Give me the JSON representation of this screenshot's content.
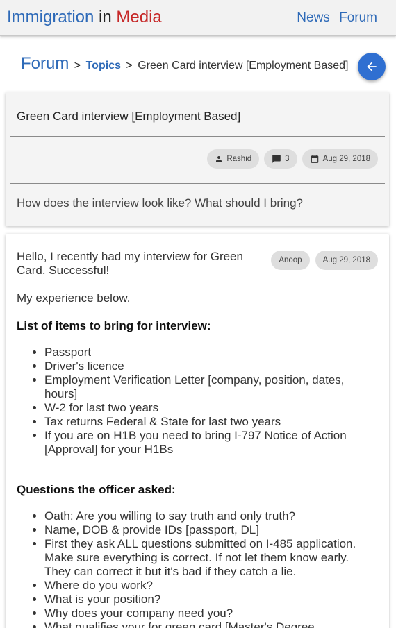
{
  "header": {
    "brand_part1": "Immigration",
    "brand_part2": "in",
    "brand_part3": "Media",
    "nav": [
      "News",
      "Forum"
    ]
  },
  "breadcrumb": {
    "forum": "Forum",
    "separator": ">",
    "topics": "Topics",
    "current": "Green Card interview [Employment Based]"
  },
  "topic": {
    "title": "Green Card interview [Employment Based]",
    "author": "Rashid",
    "reply_count": "3",
    "date": "Aug 29, 2018",
    "question": "How does the interview look like? What should I bring?"
  },
  "post": {
    "author": "Anoop",
    "date": "Aug 29, 2018",
    "intro": "Hello, I recently had my interview for Green Card. Successful!",
    "experience": "My experience below.",
    "items_heading": "List of items to bring for interview:",
    "items": [
      "Passport",
      "Driver's licence",
      "Employment Verification Letter [company, position, dates, hours]",
      "W-2 for last two years",
      "Tax returns Federal & State for last two years",
      "If you are on H1B you need to bring I-797 Notice of Action [Approval] for your H1Bs"
    ],
    "questions_heading": "Questions the officer asked:",
    "questions": [
      "Oath: Are you willing to say truth and only truth?",
      "Name, DOB & provide IDs [passport, DL]",
      "First they ask ALL questions submitted on I-485 application. Make sure everything is correct. If not let them know early. They can correct it but it's bad if they catch a lie.",
      "Where do you work?",
      "What is your position?",
      "Why does your company need you?",
      "What qualifies your for green card [Master's Degree"
    ]
  },
  "colors": {
    "link_blue": "#2e6ab8",
    "brand_red": "#c62828",
    "fab_blue": "#2f6fd1"
  },
  "icons": {
    "back": "arrow-left-icon",
    "author": "person-icon",
    "replies": "comment-icon",
    "date": "calendar-icon"
  }
}
